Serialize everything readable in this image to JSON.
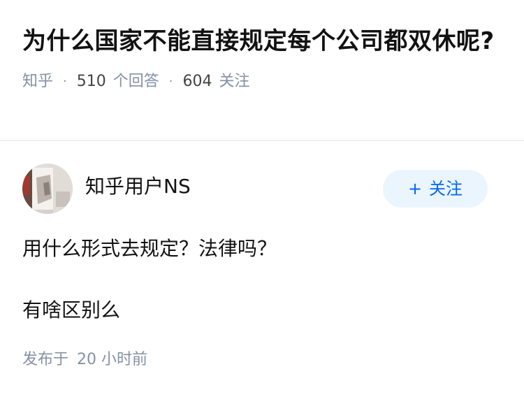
{
  "question": {
    "title": "为什么国家不能直接规定每个公司都双休呢?",
    "source": "知乎",
    "separator": "·",
    "answer_count": "510",
    "answer_label": "个回答",
    "follower_count": "604",
    "follower_label": "关注"
  },
  "answer": {
    "author_name": "知乎用户NS",
    "follow_button": {
      "icon": "+",
      "label": "关注"
    },
    "paragraphs": [
      "用什么形式去规定？法律吗？",
      "有啥区别么"
    ],
    "published_label": "发布于",
    "published_time": "20 小时前"
  },
  "colors": {
    "accent": "#0066ff",
    "follow_bg": "#ebf5fd",
    "meta_gray": "#8590a6",
    "text": "#121212"
  }
}
